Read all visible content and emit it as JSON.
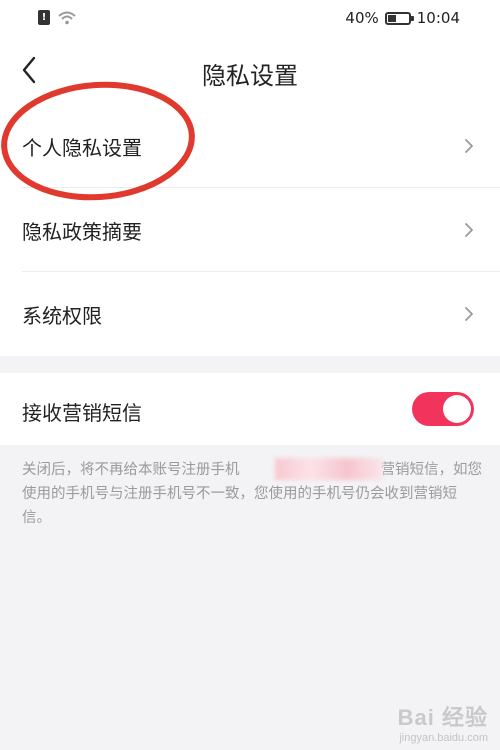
{
  "status_bar": {
    "battery_percent": "40%",
    "time": "10:04",
    "battery_level": 0.4
  },
  "header": {
    "title": "隐私设置",
    "back_icon": "chevron-left-icon"
  },
  "menu": {
    "items": [
      {
        "label": "个人隐私设置",
        "icon": "chevron-right-icon"
      },
      {
        "label": "隐私政策摘要",
        "icon": "chevron-right-icon"
      },
      {
        "label": "系统权限",
        "icon": "chevron-right-icon"
      }
    ]
  },
  "sms": {
    "label": "接收营销短信",
    "enabled": true,
    "accent_color": "#f2345c"
  },
  "note": {
    "text_before": "关闭后，将不再给本账号注册手机",
    "text_after": "发送营销短信，如您使用的手机号与注册手机号不一致，您使用的手机号仍会收到营销短信。"
  },
  "watermark": {
    "brand": "Bai 经验",
    "url": "jingyan.baidu.com"
  }
}
